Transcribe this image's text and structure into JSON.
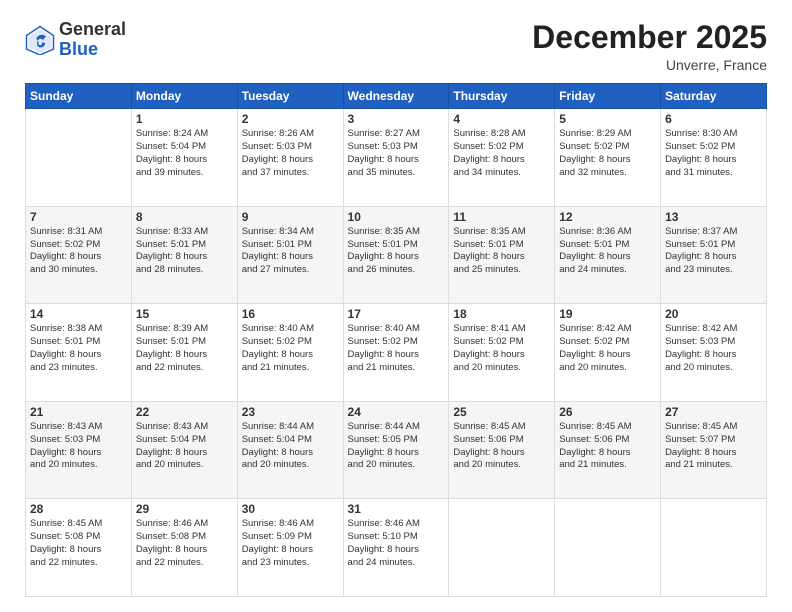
{
  "header": {
    "logo_general": "General",
    "logo_blue": "Blue",
    "month_year": "December 2025",
    "location": "Unverre, France"
  },
  "days_of_week": [
    "Sunday",
    "Monday",
    "Tuesday",
    "Wednesday",
    "Thursday",
    "Friday",
    "Saturday"
  ],
  "weeks": [
    [
      {
        "day": "",
        "lines": []
      },
      {
        "day": "1",
        "lines": [
          "Sunrise: 8:24 AM",
          "Sunset: 5:04 PM",
          "Daylight: 8 hours",
          "and 39 minutes."
        ]
      },
      {
        "day": "2",
        "lines": [
          "Sunrise: 8:26 AM",
          "Sunset: 5:03 PM",
          "Daylight: 8 hours",
          "and 37 minutes."
        ]
      },
      {
        "day": "3",
        "lines": [
          "Sunrise: 8:27 AM",
          "Sunset: 5:03 PM",
          "Daylight: 8 hours",
          "and 35 minutes."
        ]
      },
      {
        "day": "4",
        "lines": [
          "Sunrise: 8:28 AM",
          "Sunset: 5:02 PM",
          "Daylight: 8 hours",
          "and 34 minutes."
        ]
      },
      {
        "day": "5",
        "lines": [
          "Sunrise: 8:29 AM",
          "Sunset: 5:02 PM",
          "Daylight: 8 hours",
          "and 32 minutes."
        ]
      },
      {
        "day": "6",
        "lines": [
          "Sunrise: 8:30 AM",
          "Sunset: 5:02 PM",
          "Daylight: 8 hours",
          "and 31 minutes."
        ]
      }
    ],
    [
      {
        "day": "7",
        "lines": [
          "Sunrise: 8:31 AM",
          "Sunset: 5:02 PM",
          "Daylight: 8 hours",
          "and 30 minutes."
        ]
      },
      {
        "day": "8",
        "lines": [
          "Sunrise: 8:33 AM",
          "Sunset: 5:01 PM",
          "Daylight: 8 hours",
          "and 28 minutes."
        ]
      },
      {
        "day": "9",
        "lines": [
          "Sunrise: 8:34 AM",
          "Sunset: 5:01 PM",
          "Daylight: 8 hours",
          "and 27 minutes."
        ]
      },
      {
        "day": "10",
        "lines": [
          "Sunrise: 8:35 AM",
          "Sunset: 5:01 PM",
          "Daylight: 8 hours",
          "and 26 minutes."
        ]
      },
      {
        "day": "11",
        "lines": [
          "Sunrise: 8:35 AM",
          "Sunset: 5:01 PM",
          "Daylight: 8 hours",
          "and 25 minutes."
        ]
      },
      {
        "day": "12",
        "lines": [
          "Sunrise: 8:36 AM",
          "Sunset: 5:01 PM",
          "Daylight: 8 hours",
          "and 24 minutes."
        ]
      },
      {
        "day": "13",
        "lines": [
          "Sunrise: 8:37 AM",
          "Sunset: 5:01 PM",
          "Daylight: 8 hours",
          "and 23 minutes."
        ]
      }
    ],
    [
      {
        "day": "14",
        "lines": [
          "Sunrise: 8:38 AM",
          "Sunset: 5:01 PM",
          "Daylight: 8 hours",
          "and 23 minutes."
        ]
      },
      {
        "day": "15",
        "lines": [
          "Sunrise: 8:39 AM",
          "Sunset: 5:01 PM",
          "Daylight: 8 hours",
          "and 22 minutes."
        ]
      },
      {
        "day": "16",
        "lines": [
          "Sunrise: 8:40 AM",
          "Sunset: 5:02 PM",
          "Daylight: 8 hours",
          "and 21 minutes."
        ]
      },
      {
        "day": "17",
        "lines": [
          "Sunrise: 8:40 AM",
          "Sunset: 5:02 PM",
          "Daylight: 8 hours",
          "and 21 minutes."
        ]
      },
      {
        "day": "18",
        "lines": [
          "Sunrise: 8:41 AM",
          "Sunset: 5:02 PM",
          "Daylight: 8 hours",
          "and 20 minutes."
        ]
      },
      {
        "day": "19",
        "lines": [
          "Sunrise: 8:42 AM",
          "Sunset: 5:02 PM",
          "Daylight: 8 hours",
          "and 20 minutes."
        ]
      },
      {
        "day": "20",
        "lines": [
          "Sunrise: 8:42 AM",
          "Sunset: 5:03 PM",
          "Daylight: 8 hours",
          "and 20 minutes."
        ]
      }
    ],
    [
      {
        "day": "21",
        "lines": [
          "Sunrise: 8:43 AM",
          "Sunset: 5:03 PM",
          "Daylight: 8 hours",
          "and 20 minutes."
        ]
      },
      {
        "day": "22",
        "lines": [
          "Sunrise: 8:43 AM",
          "Sunset: 5:04 PM",
          "Daylight: 8 hours",
          "and 20 minutes."
        ]
      },
      {
        "day": "23",
        "lines": [
          "Sunrise: 8:44 AM",
          "Sunset: 5:04 PM",
          "Daylight: 8 hours",
          "and 20 minutes."
        ]
      },
      {
        "day": "24",
        "lines": [
          "Sunrise: 8:44 AM",
          "Sunset: 5:05 PM",
          "Daylight: 8 hours",
          "and 20 minutes."
        ]
      },
      {
        "day": "25",
        "lines": [
          "Sunrise: 8:45 AM",
          "Sunset: 5:06 PM",
          "Daylight: 8 hours",
          "and 20 minutes."
        ]
      },
      {
        "day": "26",
        "lines": [
          "Sunrise: 8:45 AM",
          "Sunset: 5:06 PM",
          "Daylight: 8 hours",
          "and 21 minutes."
        ]
      },
      {
        "day": "27",
        "lines": [
          "Sunrise: 8:45 AM",
          "Sunset: 5:07 PM",
          "Daylight: 8 hours",
          "and 21 minutes."
        ]
      }
    ],
    [
      {
        "day": "28",
        "lines": [
          "Sunrise: 8:45 AM",
          "Sunset: 5:08 PM",
          "Daylight: 8 hours",
          "and 22 minutes."
        ]
      },
      {
        "day": "29",
        "lines": [
          "Sunrise: 8:46 AM",
          "Sunset: 5:08 PM",
          "Daylight: 8 hours",
          "and 22 minutes."
        ]
      },
      {
        "day": "30",
        "lines": [
          "Sunrise: 8:46 AM",
          "Sunset: 5:09 PM",
          "Daylight: 8 hours",
          "and 23 minutes."
        ]
      },
      {
        "day": "31",
        "lines": [
          "Sunrise: 8:46 AM",
          "Sunset: 5:10 PM",
          "Daylight: 8 hours",
          "and 24 minutes."
        ]
      },
      {
        "day": "",
        "lines": []
      },
      {
        "day": "",
        "lines": []
      },
      {
        "day": "",
        "lines": []
      }
    ]
  ]
}
